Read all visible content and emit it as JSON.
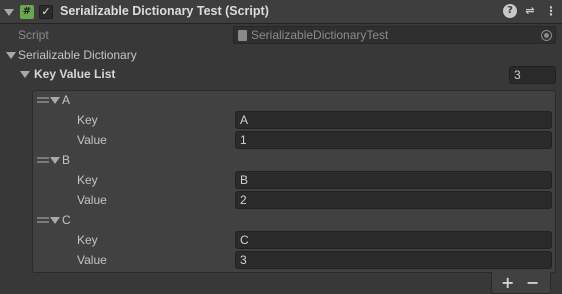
{
  "header": {
    "script_icon_glyph": "#",
    "enabled_checkmark": "✓",
    "title": "Serializable Dictionary Test (Script)",
    "help_glyph": "?",
    "preset_glyph": "⇌",
    "menu_glyph": "⋮"
  },
  "script_field": {
    "label": "Script",
    "value": "SerializableDictionaryTest"
  },
  "dictionary": {
    "label": "Serializable Dictionary",
    "list": {
      "label": "Key Value List",
      "size": "3",
      "items": [
        {
          "name": "A",
          "key_label": "Key",
          "key": "A",
          "value_label": "Value",
          "value": "1"
        },
        {
          "name": "B",
          "key_label": "Key",
          "key": "B",
          "value_label": "Value",
          "value": "2"
        },
        {
          "name": "C",
          "key_label": "Key",
          "key": "C",
          "value_label": "Value",
          "value": "3"
        }
      ],
      "add_glyph": "+",
      "remove_glyph": "−"
    }
  },
  "icons": {
    "script_icon": "script-icon",
    "foldout": "triangle-down-icon",
    "drag_handle": "drag-handle-icon",
    "object_picker": "target-icon"
  },
  "colors": {
    "background": "#383838",
    "header": "#3e3e3e",
    "field": "#2a2a2a",
    "script_icon": "#6aa84f"
  }
}
